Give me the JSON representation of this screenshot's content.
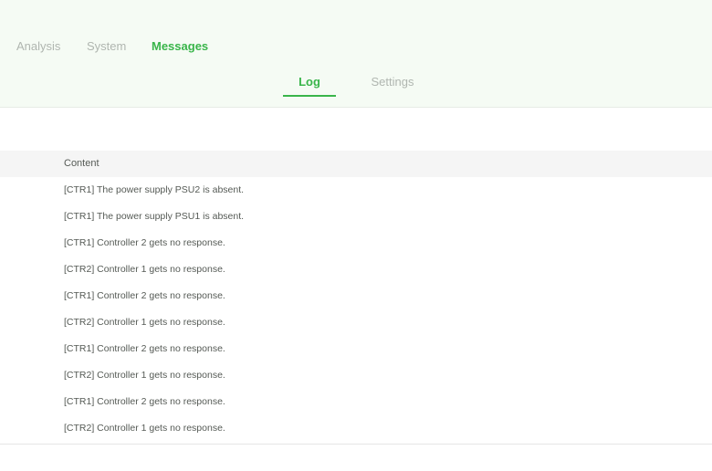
{
  "nav": {
    "tabs": [
      {
        "label": "Analysis",
        "active": false
      },
      {
        "label": "System",
        "active": false
      },
      {
        "label": "Messages",
        "active": true
      }
    ]
  },
  "subnav": {
    "tabs": [
      {
        "label": "Log",
        "active": true
      },
      {
        "label": "Settings",
        "active": false
      }
    ]
  },
  "table": {
    "header": "Content",
    "rows": [
      "[CTR1] The power supply PSU2 is absent.",
      "[CTR1] The power supply PSU1 is absent.",
      "[CTR1] Controller 2 gets no response.",
      "[CTR2] Controller 1 gets no response.",
      "[CTR1] Controller 2 gets no response.",
      "[CTR2] Controller 1 gets no response.",
      "[CTR1] Controller 2 gets no response.",
      "[CTR2] Controller 1 gets no response.",
      "[CTR1] Controller 2 gets no response.",
      "[CTR2] Controller 1 gets no response."
    ]
  },
  "colors": {
    "accent": "#39b54a",
    "header_bg": "#f5fbf4",
    "inactive_text": "#b0b6b0",
    "body_text": "#555a55"
  }
}
